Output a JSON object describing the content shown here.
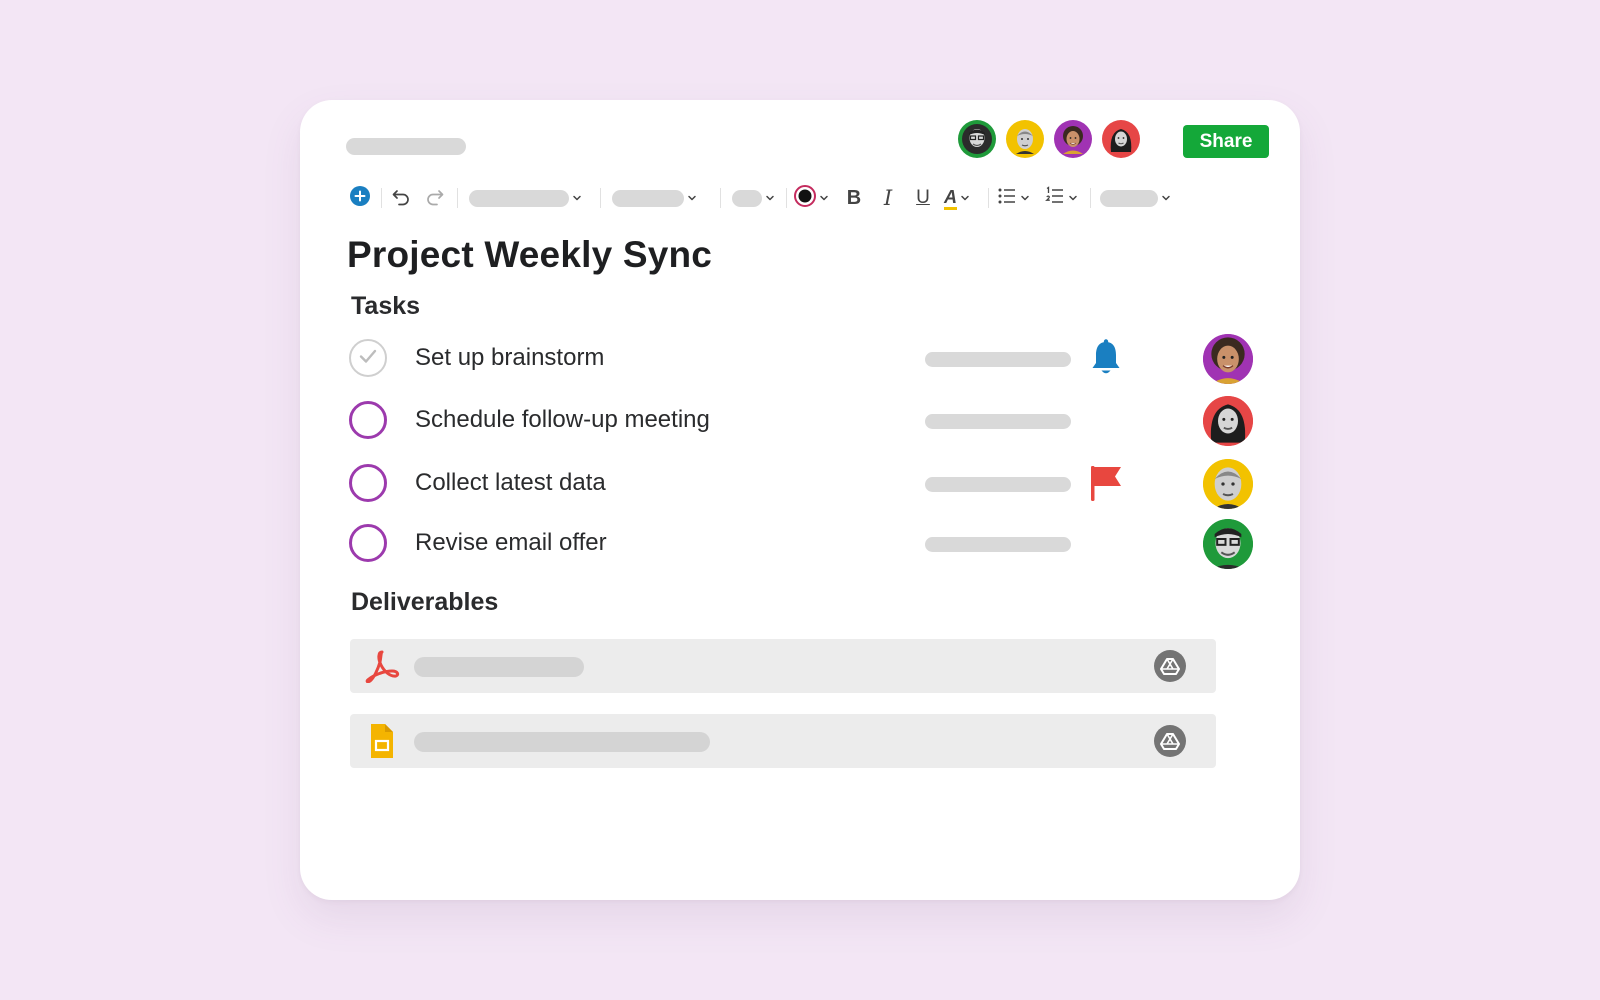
{
  "header": {
    "collaborators": [
      {
        "icon": "avatar-man-glasses",
        "ring": "#1f9a3a"
      },
      {
        "icon": "avatar-man-bald",
        "ring": "#f2c200"
      },
      {
        "icon": "avatar-woman-curly",
        "ring": "#a033b3"
      },
      {
        "icon": "avatar-woman-dark-hair",
        "ring": "#e64646"
      }
    ],
    "share_label": "Share"
  },
  "toolbar": {
    "insert_icon": "plus-circle-icon",
    "undo_icon": "undo-icon",
    "redo_icon": "redo-icon",
    "text_color": "#111111",
    "bold_label": "B",
    "italic_label": "I",
    "underline_label": "U",
    "highlight_label": "A"
  },
  "document": {
    "title": "Project Weekly Sync",
    "tasks_heading": "Tasks",
    "tasks": [
      {
        "label": "Set up brainstorm",
        "completed": true,
        "marker": "bell-icon",
        "assignee": "avatar-woman-curly"
      },
      {
        "label": "Schedule follow-up meeting",
        "completed": false,
        "marker": "",
        "assignee": "avatar-woman-dark-hair"
      },
      {
        "label": "Collect latest data",
        "completed": false,
        "marker": "flag-icon",
        "assignee": "avatar-man-bald"
      },
      {
        "label": "Revise email offer",
        "completed": false,
        "marker": "",
        "assignee": "avatar-man-glasses"
      }
    ],
    "deliverables_heading": "Deliverables",
    "deliverables": [
      {
        "file_icon": "pdf-icon",
        "action_icon": "google-drive-icon"
      },
      {
        "file_icon": "google-slides-icon",
        "action_icon": "google-drive-icon"
      }
    ]
  },
  "colors": {
    "accent_green": "#14a839",
    "checkbox_purple": "#9c3aad",
    "bell_blue": "#1a7fc1",
    "flag_red": "#e8473f",
    "pdf_red": "#e8473f",
    "slides_yellow": "#f4b400"
  }
}
